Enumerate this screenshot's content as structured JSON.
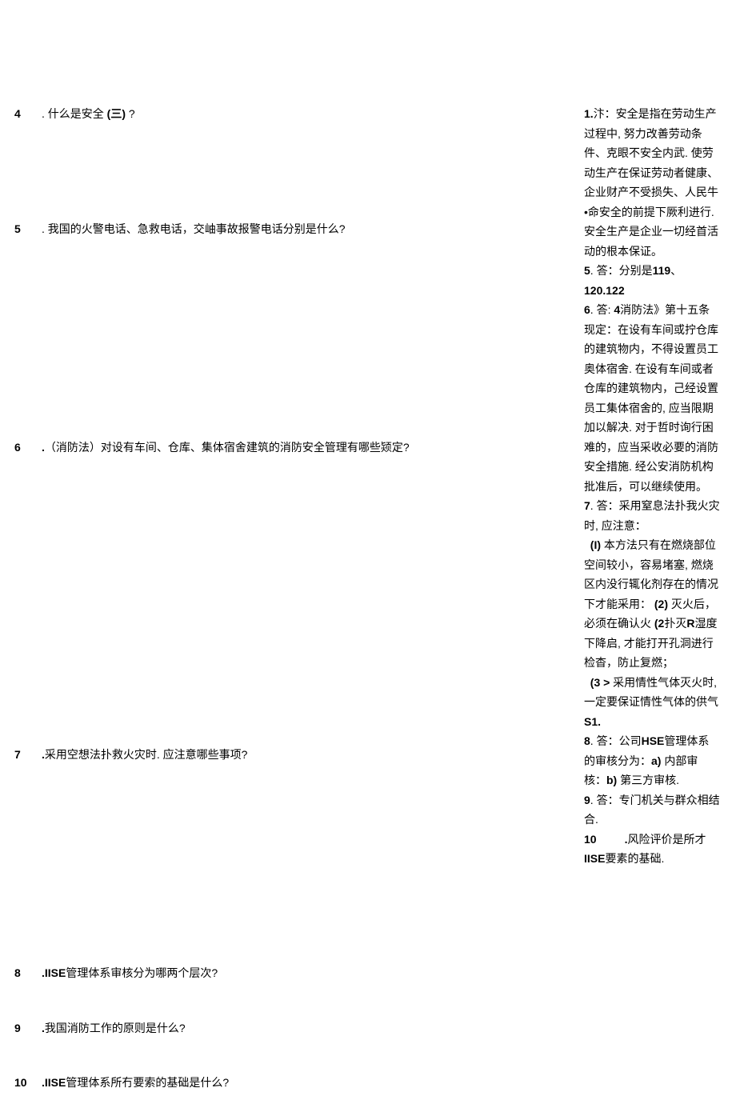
{
  "questions": {
    "q4": {
      "num": "4",
      "text_prefix": ". 什么是安全 ",
      "bold_seg": "(三)",
      "suffix": " ?"
    },
    "q5": {
      "num": "5",
      "text": ". 我国的火警电话、急救电话，交岫事故报警电话分别是什么?"
    },
    "q6": {
      "num": "6",
      "lead": " .",
      "text": "（消防法）对设有车间、仓库、集体宿舍建筑的消防安全管理有哪些颎定?"
    },
    "q7": {
      "num": "7",
      "lead": " .",
      "text": "采用空想法扑救火灾时. 应注意哪些事项?"
    },
    "q8": {
      "num": "8",
      "lead": " .IISE",
      "text": "管理体系审核分为哪两个层次?"
    },
    "q9": {
      "num": "9",
      "lead": " .",
      "text": "我国消防工作的原则是什么?"
    },
    "q10": {
      "num": "10",
      "lead": "  .IISE",
      "text": "管理体系所冇要索的基础是什么?"
    }
  },
  "answers": {
    "a1_label": "1.",
    "a1": "汴：安全是指在劳动生产过程中, 努力改善劳动条件、克眼不安全内武. 使劳动生产在保证劳动者健康、企业财产不受损失、人民牛•命安全的前提下厥利进行. 安全生产是企业一切经首活动的根本保证。",
    "a5_label": "5",
    "a5_prefix": ". 答：分别是",
    "a5_bold1": "119",
    "a5_mid": "、",
    "a5_bold2": "120.122",
    "a6_label": "6",
    "a6_prefix": ". 答: ",
    "a6_bold": "4",
    "a6_text": "消防法》第十五条现定：在设有车间或拧仓库的建筑物内，不得设置员工奥体宿舍. 在设有车间或者仓库的建筑物内，己经设置员工集体宿舍的, 应当限期加以解决. 对于哲时询行困难的，应当采收必要的消防安全措施. 经公安消防机构批准后，可以继续使用。",
    "a7_label": "7",
    "a7_intro": ". 答：采用窒息法扑我火灾时, 应注意：",
    "a7_p1_bold": "(I)",
    "a7_p1": " 本方法只有在燃烧部位空间较小，容易堵塞, 燃烧区内没行辄化剂存在的情况下才能采用：  ",
    "a7_p2_bold": "(2)",
    "a7_p2_a": " 灭火后，必须在确认火 ",
    "a7_p2_bold2": "(2",
    "a7_p2_b": "扑灭",
    "a7_p2_boldR": "R",
    "a7_p2_c": "湿度下降启, 才能打开孔洞进行检杳，防止复燃；",
    "a7_p3_bold": "(3 >",
    "a7_p3": " 采用情性气体灭火时, 一定要保证情性气体的供气",
    "a7_p3_bold2": "S1.",
    "a8_label": "8",
    "a8_prefix": ". 答：公司",
    "a8_hse": "HSE",
    "a8_mid": "管理体系的审核分为：",
    "a8_a": "a)",
    "a8_atext": " 内部审核：",
    "a8_b": "b)",
    "a8_btext": " 第三方审核.",
    "a9_label": "9",
    "a9_text": ". 答：专门机关与群众相结合.",
    "a10_label": "10",
    "a10_lead": "         .",
    "a10_text_a": "风险评价是所才",
    "a10_bold": "IISE",
    "a10_text_b": "要素的基础."
  },
  "spacing": {
    "after_q4": "115px",
    "after_q5": "245px",
    "after_q6": "355px",
    "after_q7": "245px",
    "after_q8": "40px",
    "after_q9": "40px"
  }
}
